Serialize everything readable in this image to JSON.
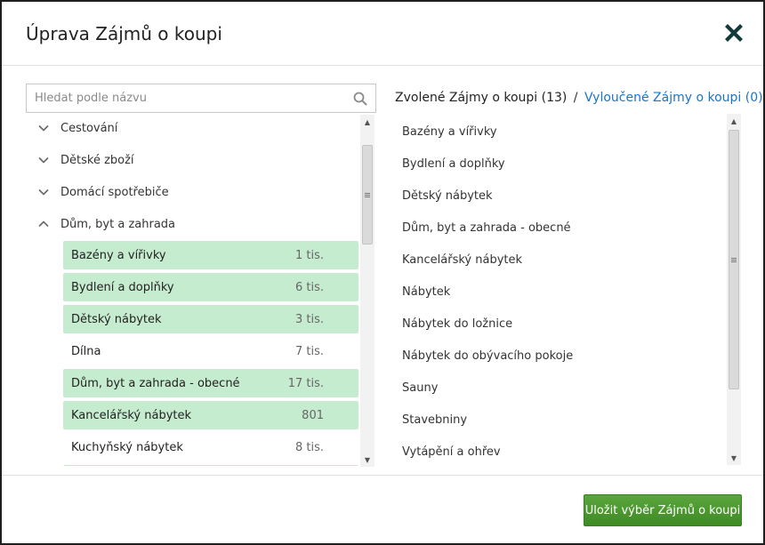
{
  "dialog": {
    "title": "Úprava Zájmů o koupi"
  },
  "search": {
    "placeholder": "Hledat podle názvu"
  },
  "left": {
    "categories": [
      {
        "label": "Cestování",
        "expanded": false
      },
      {
        "label": "Dětské zboží",
        "expanded": false
      },
      {
        "label": "Domácí spotřebiče",
        "expanded": false
      },
      {
        "label": "Dům, byt a zahrada",
        "expanded": true
      }
    ],
    "items": [
      {
        "label": "Bazény a vířivky",
        "count": "1 tis.",
        "selected": true
      },
      {
        "label": "Bydlení a doplňky",
        "count": "6 tis.",
        "selected": true
      },
      {
        "label": "Dětský nábytek",
        "count": "3 tis.",
        "selected": true
      },
      {
        "label": "Dílna",
        "count": "7 tis.",
        "selected": false
      },
      {
        "label": "Dům, byt a zahrada - obecné",
        "count": "17 tis.",
        "selected": true
      },
      {
        "label": "Kancelářský nábytek",
        "count": "801",
        "selected": true
      },
      {
        "label": "Kuchyňský nábytek",
        "count": "8 tis.",
        "selected": false
      }
    ]
  },
  "right": {
    "selected_tab": "Zvolené Zájmy o koupi (13)",
    "separator": "/",
    "excluded_tab": "Vyloučené Zájmy o koupi (0)",
    "items": [
      "Bazény a vířivky",
      "Bydlení a doplňky",
      "Dětský nábytek",
      "Dům, byt a zahrada - obecné",
      "Kancelářský nábytek",
      "Nábytek",
      "Nábytek do ložnice",
      "Nábytek do obývacího pokoje",
      "Sauny",
      "Stavebniny",
      "Vytápění a ohřev"
    ]
  },
  "footer": {
    "save_label": "Uložit výběr Zájmů o koupi"
  },
  "colors": {
    "selected_bg": "#c6ecd0",
    "link": "#1b74c9",
    "button": "#4a9a2f",
    "close_icon": "#0f3b3a"
  }
}
